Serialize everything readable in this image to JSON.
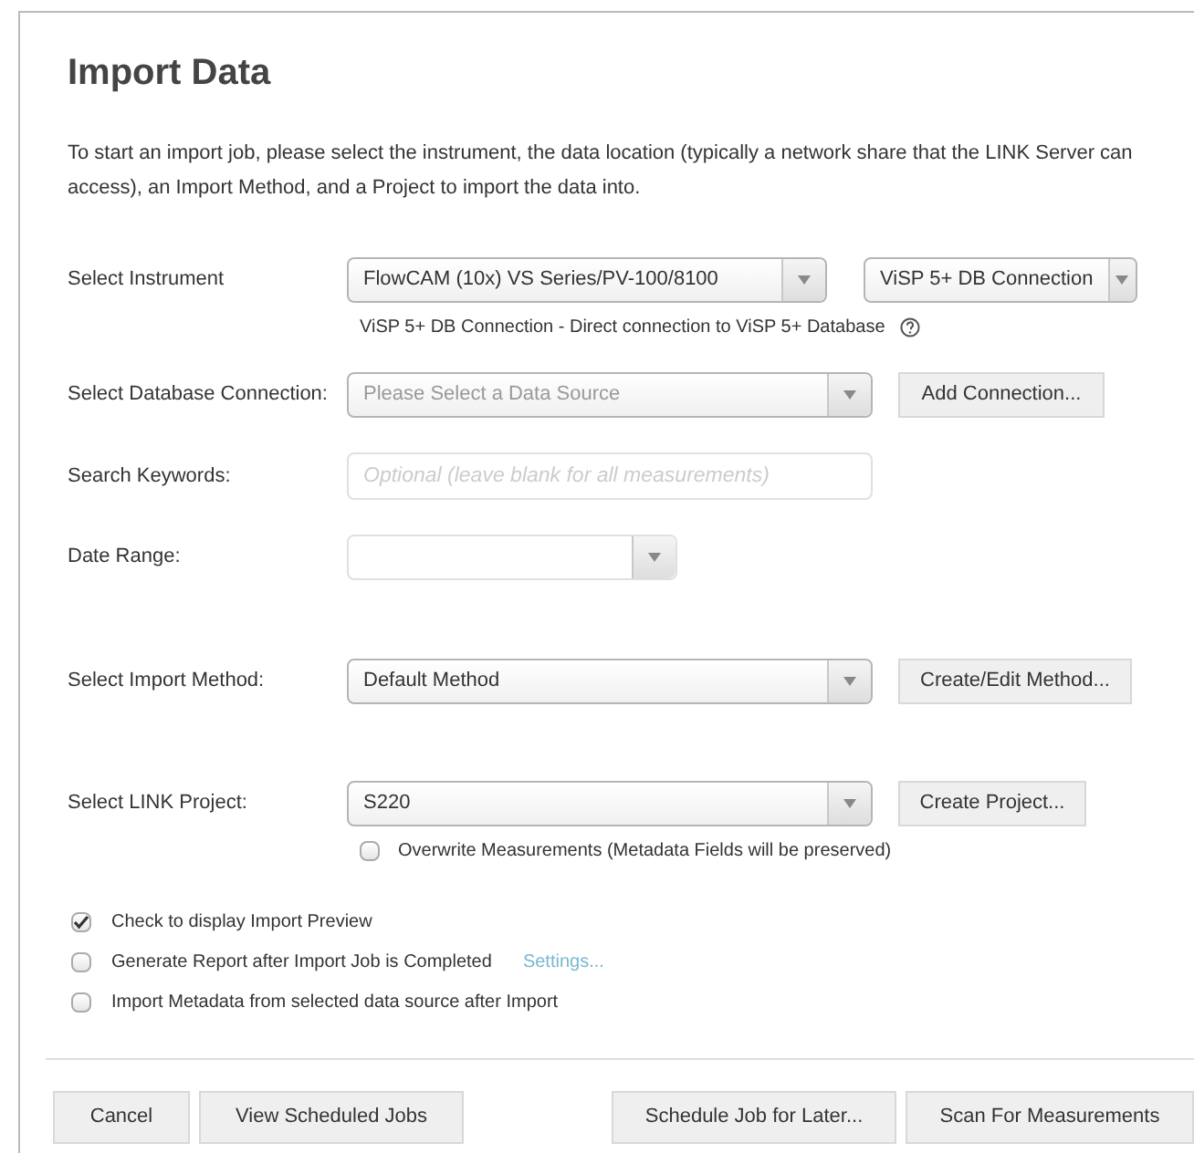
{
  "dialog": {
    "title": "Import Data",
    "intro": "To start an import job, please select the instrument, the data location (typically a network share that the LINK Server can access), an Import Method, and a Project to import the data into."
  },
  "instrument": {
    "label": "Select Instrument",
    "value": "FlowCAM (10x) VS Series/PV-100/8100",
    "connection": "ViSP 5+ DB Connection",
    "help": "ViSP 5+ DB Connection - Direct connection to ViSP 5+ Database"
  },
  "database": {
    "label": "Select Database Connection:",
    "placeholder": "Please Select a Data Source",
    "button": "Add Connection..."
  },
  "keywords": {
    "label": "Search Keywords:",
    "placeholder": "Optional (leave blank for all measurements)"
  },
  "date_range": {
    "label": "Date Range:"
  },
  "method": {
    "label": "Select Import Method:",
    "value": "Default Method",
    "button": "Create/Edit Method..."
  },
  "project": {
    "label": "Select LINK Project:",
    "value": "S220",
    "button": "Create Project...",
    "overwrite": {
      "label": "Overwrite Measurements (Metadata Fields will be preserved)",
      "checked": false
    }
  },
  "options": [
    {
      "label": "Check to display Import Preview",
      "checked": true
    },
    {
      "label": "Generate Report after Import Job is Completed",
      "checked": false,
      "link": "Settings..."
    },
    {
      "label": "Import Metadata from selected data source after Import",
      "checked": false
    }
  ],
  "footer": {
    "left": [
      "Cancel",
      "View Scheduled Jobs"
    ],
    "right": [
      "Schedule Job for Later...",
      "Scan For Measurements"
    ]
  }
}
